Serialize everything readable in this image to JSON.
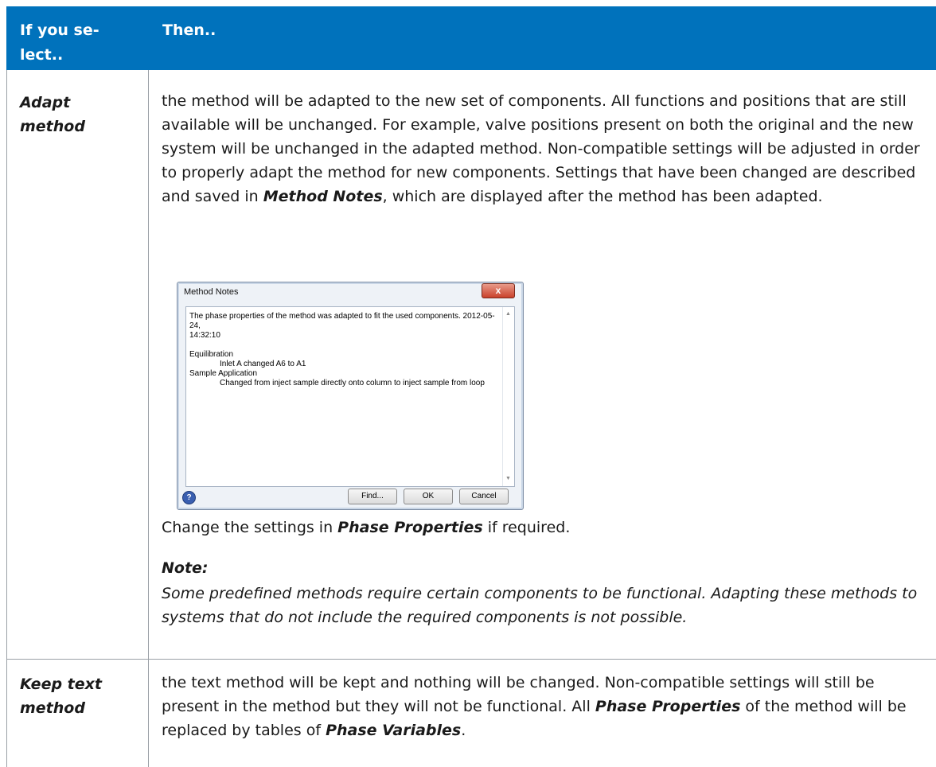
{
  "header": {
    "col1": "If you se-\nlect..",
    "col2": "Then.."
  },
  "rows": [
    {
      "label": "Adapt\nmethod",
      "intro": "the method will be adapted to the new set of components. All functions and positions that are still available will be unchanged. For example, valve positions present on both the original and the new system will be unchanged in the adapted method. Non-compatible settings will be adjusted in order to properly adapt the method for new components. Settings that have been changed are described and saved in ",
      "intro_bold": "Method Notes",
      "intro_end": ", which are displayed after the method has been adapted.",
      "change_pre": "Change the settings in ",
      "change_bold": "Phase Properties",
      "change_post": " if required.",
      "note_heading": "Note:",
      "note_text": "Some predefined methods require certain components to be functional. Adapting these methods to systems that do not include the required components is not possible."
    },
    {
      "label": "Keep text\nmethod",
      "t1": "the text method will be kept and nothing will be changed. Non-compatible settings will still be present in the method but they will not be functional. All ",
      "b1": "Phase Properties",
      "t2": " of the method will be replaced by tables of ",
      "b2": "Phase Variables",
      "t3": "."
    }
  ],
  "dialog": {
    "title": "Method Notes",
    "close": "x",
    "lines": [
      "The phase properties of the method was adapted to fit the used components. 2012-05-24,",
      "14:32:10",
      "",
      "Equilibration",
      "Inlet A changed A6 to A1",
      "Sample Application",
      "Changed from inject sample directly onto column to inject sample from loop"
    ],
    "help": "?",
    "find": "Find...",
    "ok": "OK",
    "cancel": "Cancel"
  }
}
